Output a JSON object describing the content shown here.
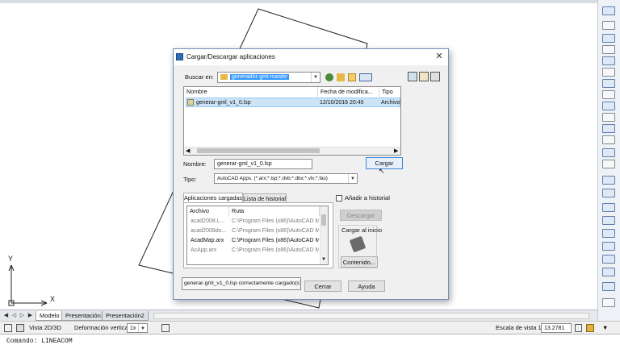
{
  "dialog": {
    "title": "Cargar/Descargar aplicaciones",
    "look_in_label": "Buscar en:",
    "look_in_value": "generador-gml-master",
    "file_list": {
      "columns": [
        "Nombre",
        "Fecha de modifica...",
        "Tipo"
      ],
      "rows": [
        {
          "name": "generar-gml_v1_0.lsp",
          "date": "12/10/2016 20:40",
          "type": "Archivo"
        }
      ]
    },
    "name_label": "Nombre:",
    "name_value": "generar-gml_v1_0.lsp",
    "type_label": "Tipo:",
    "type_value": "AutoCAD Apps. (*.arx;*.lsp;*.dvb;*.dbx;*.vlx;*.fas)",
    "load_button": "Cargar",
    "tabs": [
      "Aplicaciones cargadas",
      "Lista de historial"
    ],
    "add_history_label": "Añadir a historial",
    "loaded_list": {
      "columns": [
        "Archivo",
        "Ruta"
      ],
      "rows": [
        {
          "file": "acad2008.L...",
          "path": "C:\\Program Files (x86)\\AutoCAD Ma",
          "dim": true
        },
        {
          "file": "acad2008do...",
          "path": "C:\\Program Files (x86)\\AutoCAD Ma",
          "dim": true
        },
        {
          "file": "AcadMap.arx",
          "path": "C:\\Program Files (x86)\\AutoCAD Ma",
          "dim": false
        },
        {
          "file": "AcApp.arx",
          "path": "C:\\Program Files (x86)\\AutoCAD Ma",
          "dim": true
        }
      ]
    },
    "unload_button": "Descargar",
    "startup_group": "Cargar al inicio",
    "contents_button": "Contenido...",
    "status_message": "generar-gml_v1_0.lsp correctamente cargado(s).",
    "close_button": "Cerrar",
    "help_button": "Ayuda"
  },
  "drawing": {
    "axis_y": "Y",
    "axis_x": "X"
  },
  "layout_tabs": [
    "Modelo",
    "Presentación1",
    "Presentación2"
  ],
  "statusbar": {
    "view_label": "Vista 2D/3D",
    "deform_label": "Deformación vertical:",
    "deform_value": "1x",
    "scale_label": "Escala de vista 1:",
    "scale_value": "13.2781"
  },
  "command_line": "Comando: LINEACOM",
  "colors": {
    "selection": "#3399ff",
    "folder": "#e8b84a",
    "dialog_border": "#6f8fb8"
  }
}
